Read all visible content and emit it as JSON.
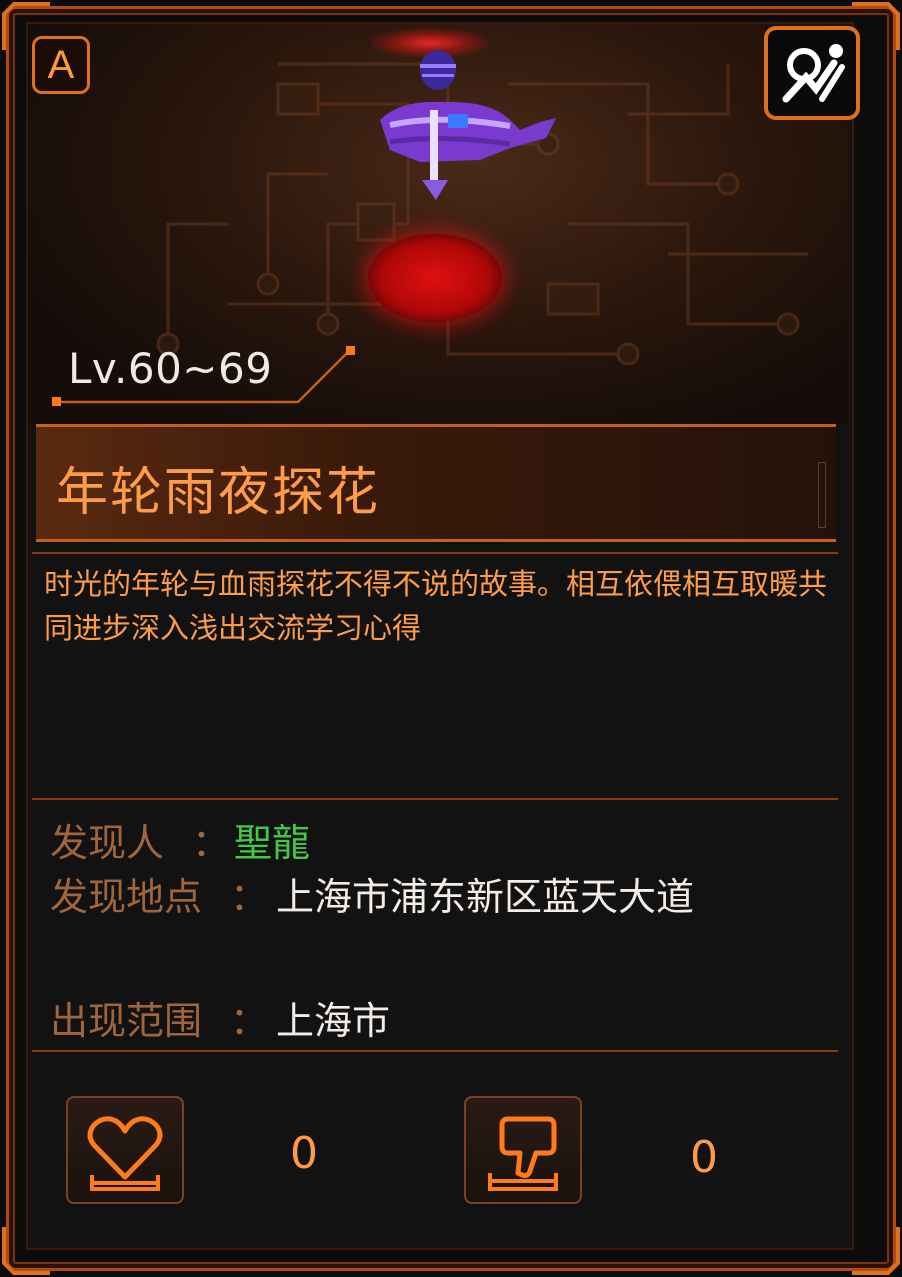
{
  "header": {
    "rank_badge": "A",
    "avatar_button_icon": "avatar-icon"
  },
  "monster": {
    "level_range": "Lv.60~69",
    "name": "年轮雨夜探花",
    "description": "时光的年轮与血雨探花不得不说的故事。相互依偎相互取暖共同进步深入浅出交流学习心得"
  },
  "details": {
    "discoverer_label": "发现人",
    "discoverer_value": "聖龍",
    "location_label": "发现地点",
    "location_value": "上海市浦东新区蓝天大道",
    "range_label": "出现范围",
    "range_value": "上海市",
    "colon": "："
  },
  "actions": {
    "like_icon": "heart-icon",
    "like_count": "0",
    "dislike_icon": "thumbs-down-icon",
    "dislike_count": "0"
  },
  "colors": {
    "accent_orange": "#ff9c4a",
    "border_orange": "#e0701c",
    "green_name": "#44c84a",
    "portal_red": "#d01010"
  }
}
